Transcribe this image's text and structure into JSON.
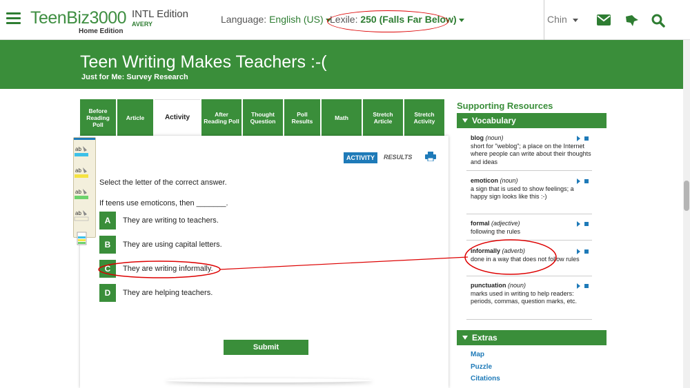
{
  "header": {
    "logo_text": "TeenBiz3000",
    "logo_subtitle": "Home Edition",
    "edition": "INTL Edition",
    "user_school": "AVERY",
    "language_label": "Language:",
    "language_value": "English (US)",
    "lexile_label": "Lexile:",
    "lexile_value": "250 (Falls Far Below)",
    "user_name": "Chin",
    "icons": [
      "menu-icon",
      "mail-icon",
      "bird-icon",
      "search-icon"
    ]
  },
  "banner": {
    "title": "Teen Writing Makes Teachers :-(",
    "subtitle": "Just for Me: Survey Research"
  },
  "tabs": [
    {
      "label": "Before Reading Poll"
    },
    {
      "label": "Article"
    },
    {
      "label": "Activity",
      "active": true
    },
    {
      "label": "After Reading Poll"
    },
    {
      "label": "Thought Question"
    },
    {
      "label": "Poll Results"
    },
    {
      "label": "Math"
    },
    {
      "label": "Stretch Article"
    },
    {
      "label": "Stretch Activity"
    }
  ],
  "activity": {
    "mode_active": "ACTIVITY",
    "mode_results": "RESULTS",
    "instruction": "Select the letter of the correct answer.",
    "question": "If teens use emoticons, then _______.",
    "options": [
      {
        "letter": "A",
        "text": "They are writing to teachers."
      },
      {
        "letter": "B",
        "text": "They are using capital letters."
      },
      {
        "letter": "C",
        "text": "They are writing informally."
      },
      {
        "letter": "D",
        "text": "They are helping teachers."
      }
    ],
    "submit_label": "Submit"
  },
  "sidebar": {
    "title": "Supporting Resources",
    "vocabulary_header": "Vocabulary",
    "vocabulary": [
      {
        "word": "blog",
        "pos": "(noun)",
        "definition": "short for \"weblog\"; a place on the Internet where people can write about their thoughts and ideas"
      },
      {
        "word": "emoticon",
        "pos": "(noun)",
        "definition": "a sign that is used to show feelings; a happy sign looks like this :-)"
      },
      {
        "word": "formal",
        "pos": "(adjective)",
        "definition": "following the rules"
      },
      {
        "word": "informally",
        "pos": "(adverb)",
        "definition": "done in a way that does not follow rules"
      },
      {
        "word": "punctuation",
        "pos": "(noun)",
        "definition": "marks used in writing to help readers: periods, commas, question marks, etc."
      }
    ],
    "extras_header": "Extras",
    "extras": [
      "Map",
      "Puzzle",
      "Citations"
    ]
  },
  "colors": {
    "brand_green": "#3a8e3a",
    "accent_blue": "#1e7ab8",
    "annotation_red": "#d00000"
  }
}
